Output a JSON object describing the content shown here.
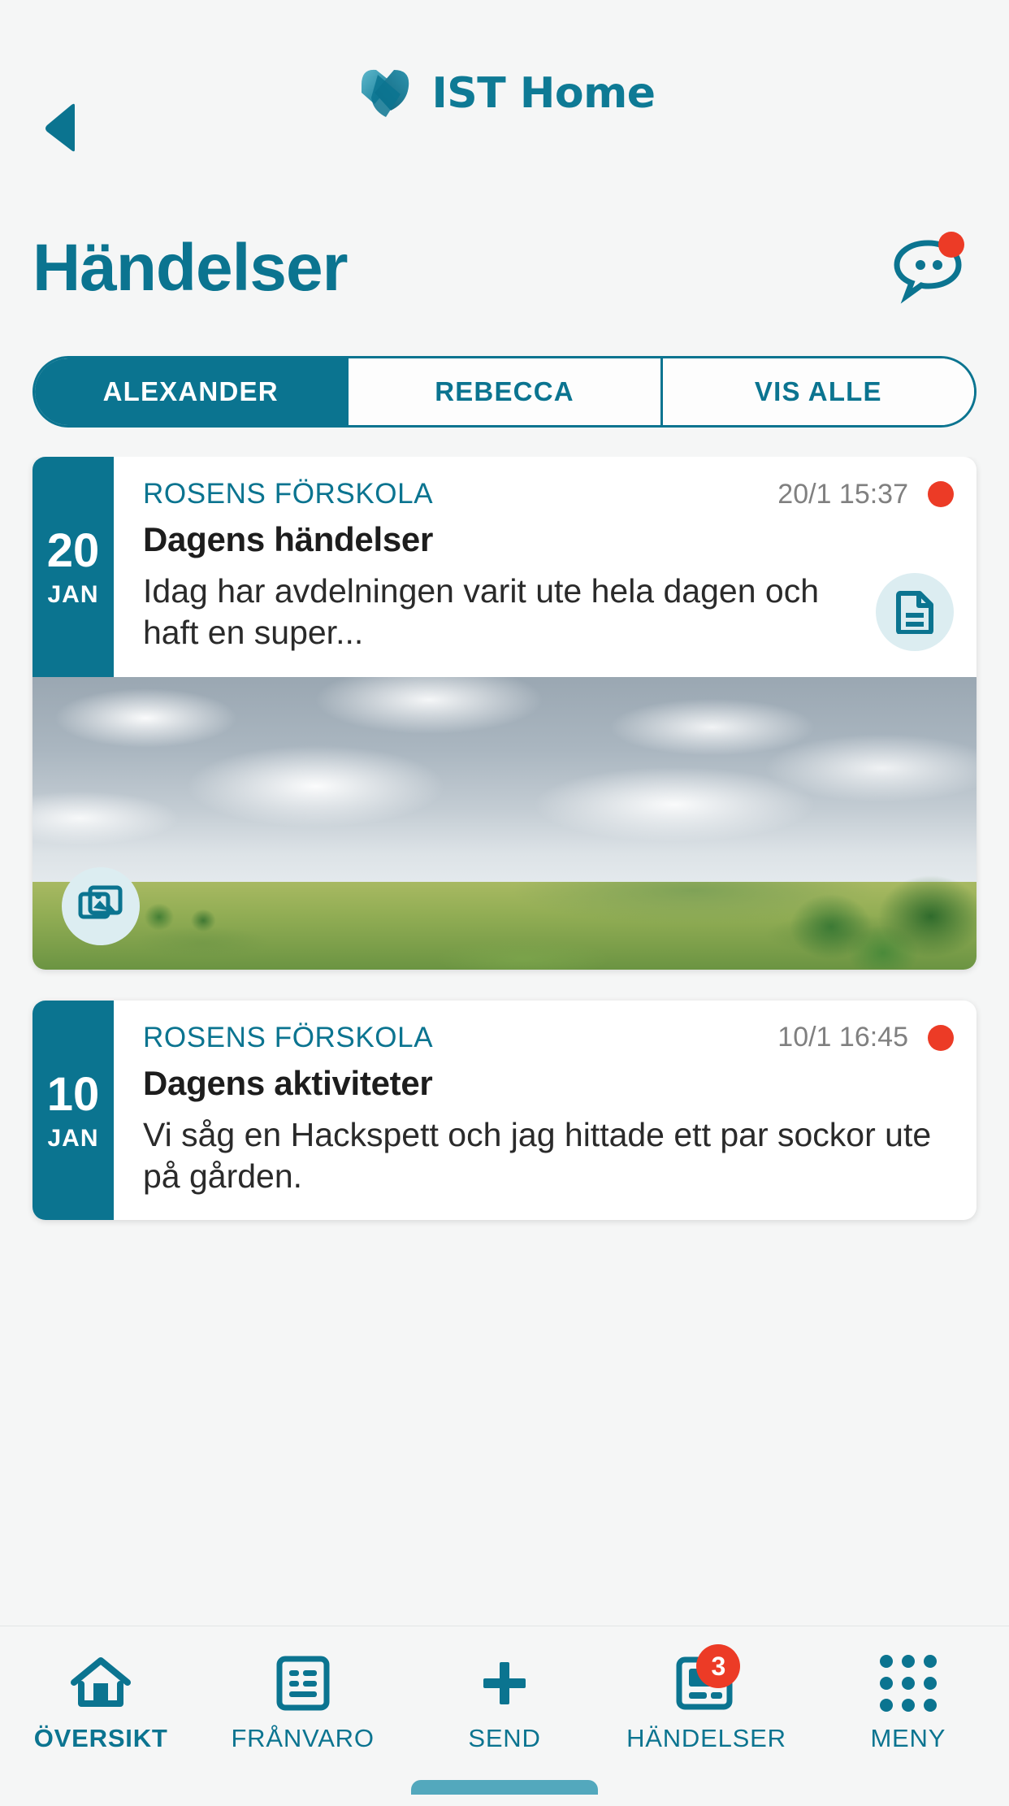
{
  "header": {
    "back_icon": "back-arrow-icon",
    "logo_icon": "ist-logo-icon",
    "logo_text": "IST Home"
  },
  "page": {
    "title": "Händelser",
    "chat_icon": "chat-bubble-icon",
    "chat_has_unread": true
  },
  "tabs": [
    {
      "label": "ALEXANDER",
      "active": true
    },
    {
      "label": "REBECCA",
      "active": false
    },
    {
      "label": "VIS ALLE",
      "active": false
    }
  ],
  "feed": [
    {
      "day": "20",
      "month": "JAN",
      "source": "ROSENS FÖRSKOLA",
      "time": "20/1 15:37",
      "unread": true,
      "title": "Dagens händelser",
      "text": "Idag har avdelningen varit ute hela dagen och haft en super...",
      "doc_icon": "document-icon",
      "has_photo": true,
      "photo_icon": "gallery-icon",
      "photo_alt": "Molnig himmel över sjö med grön äng"
    },
    {
      "day": "10",
      "month": "JAN",
      "source": "ROSENS FÖRSKOLA",
      "time": "10/1 16:45",
      "unread": true,
      "title": "Dagens aktiviteter",
      "text": "Vi såg en Hackspett och jag hittade ett par sockor ute på gården.",
      "has_photo": false
    }
  ],
  "bottom_nav": [
    {
      "label": "ÖVERSIKT",
      "icon": "home-icon",
      "active": true,
      "badge": null
    },
    {
      "label": "FRÅNVARO",
      "icon": "document-list-icon",
      "active": false,
      "badge": null
    },
    {
      "label": "SEND",
      "icon": "plus-icon",
      "active": false,
      "badge": null
    },
    {
      "label": "HÄNDELSER",
      "icon": "news-icon",
      "active": false,
      "badge": "3"
    },
    {
      "label": "MENY",
      "icon": "grid-dots-icon",
      "active": false,
      "badge": null
    }
  ],
  "colors": {
    "brand_teal": "#0b7490",
    "accent_red": "#ec3b26",
    "page_bg": "#f5f6f6",
    "card_bg": "#ffffff",
    "icon_circle_bg": "#dcedf1",
    "home_indicator": "#53a8bd"
  }
}
